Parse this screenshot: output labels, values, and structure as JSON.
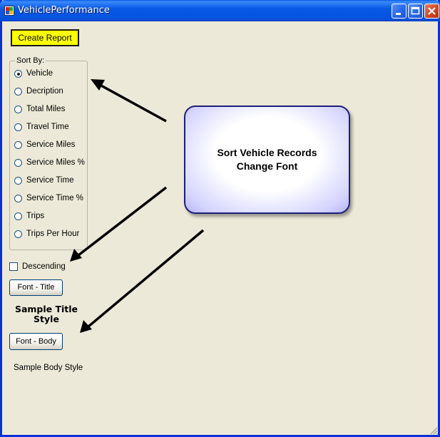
{
  "window": {
    "title": "VehiclePerformance",
    "controls": {
      "minimize": "minimize-icon",
      "maximize": "maximize-icon",
      "close": "close-icon"
    }
  },
  "toolbar": {
    "create_report_label": "Create Report"
  },
  "sort_group": {
    "legend": "Sort By:",
    "options": [
      {
        "label": "Vehicle",
        "selected": true
      },
      {
        "label": "Decription",
        "selected": false
      },
      {
        "label": "Total Miles",
        "selected": false
      },
      {
        "label": "Travel Time",
        "selected": false
      },
      {
        "label": "Service Miles",
        "selected": false
      },
      {
        "label": "Service Miles %",
        "selected": false
      },
      {
        "label": "Service Time",
        "selected": false
      },
      {
        "label": "Service Time %",
        "selected": false
      },
      {
        "label": "Trips",
        "selected": false
      },
      {
        "label": "Trips Per Hour",
        "selected": false
      }
    ]
  },
  "descending": {
    "label": "Descending",
    "checked": false
  },
  "font_title_button": "Font - Title",
  "sample_title": "Sample Title Style",
  "font_body_button": "Font - Body",
  "sample_body": "Sample Body Style",
  "callout": {
    "line1": "Sort Vehicle Records",
    "line2": "Change Font"
  },
  "colors": {
    "create_button_bg": "#ffff00",
    "title_bar": "#0553df",
    "window_bg": "#ece9d8",
    "callout_border": "#1b1f7a"
  }
}
